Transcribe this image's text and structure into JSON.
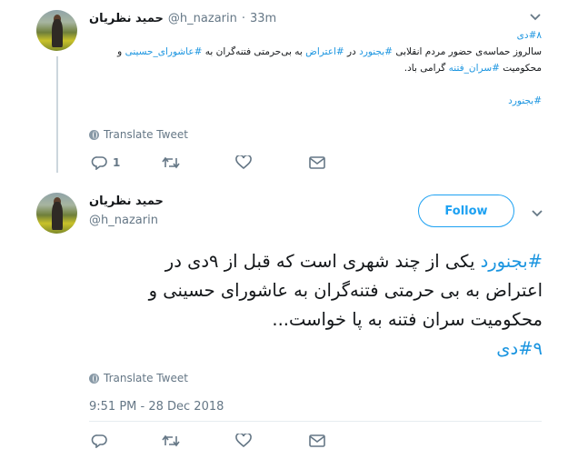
{
  "reply_tweet": {
    "author_name": "حمید نظریان",
    "handle": "@h_nazarin",
    "separator": "·",
    "time": "33m",
    "text_line1_parts": [
      {
        "t": "#۸دی",
        "tag": true
      }
    ],
    "line2": {
      "a": "سالروز حماسه‌ی حضور مردم انقلابی ",
      "tag1": "#بجنورد",
      "b": " در ",
      "tag2": "#اعتراض",
      "c": " به بی‌حرمتی فتنه‌گران به ",
      "tag3": "#عاشورای_حسینی",
      "d": " و"
    },
    "line3": {
      "a": "محکومیت ",
      "tag1": "#سران_فتنه",
      "b": " گرامی باد."
    },
    "tag_line": "#بجنورد",
    "translate_label": "Translate Tweet",
    "reply_count": "1"
  },
  "main_tweet": {
    "author_name": "حمید نظریان",
    "handle": "@h_nazarin",
    "follow_label": "Follow",
    "line1": {
      "tag": "#بجنورد",
      "rest": " یکی از چند شهری است که قبل از ۹دی در"
    },
    "line2": "اعتراض به بی حرمتی فتنه‌گران به عاشورای حسینی و",
    "line3": "محکومیت سران فتنه به پا خواست...",
    "line4_tag": "#۹دی",
    "translate_label": "Translate Tweet",
    "timestamp": "9:51 PM - 28 Dec 2018"
  },
  "icons": {
    "reply": "reply-icon",
    "retweet": "retweet-icon",
    "like": "heart-icon",
    "message": "envelope-icon",
    "more": "chevron-down-icon",
    "translate": "globe-icon"
  },
  "colors": {
    "accent": "#1da1f2",
    "hashtag": "#1b95e0",
    "muted": "#657786",
    "divider": "#e6ecf0"
  }
}
